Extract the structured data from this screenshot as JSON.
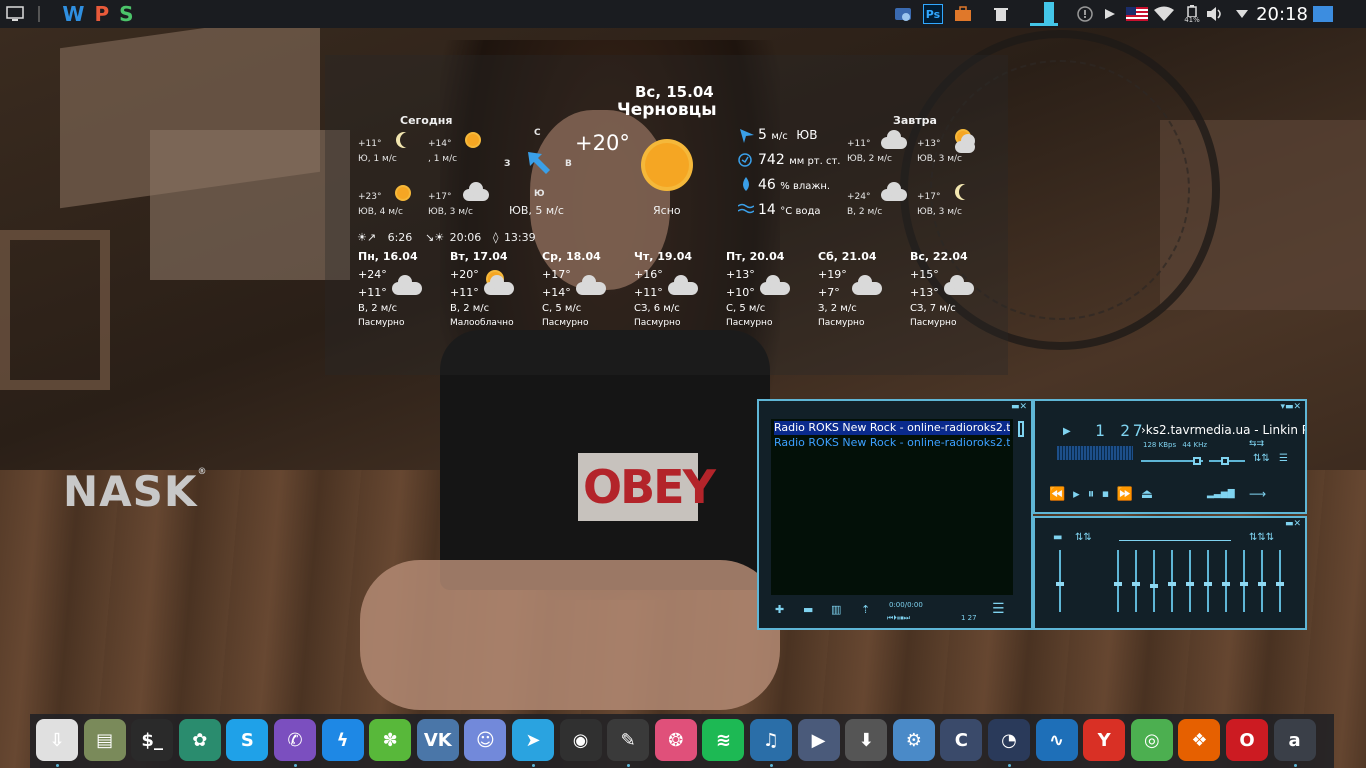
{
  "top_panel": {
    "wps_letters": [
      "W",
      "P",
      "S"
    ],
    "wps_colors": [
      "#2f8fe0",
      "#e85a3a",
      "#4cc46a"
    ],
    "tray_icons": [
      "desktop-icon",
      "lock-screen-icon",
      "photoshop-icon",
      "toolbox-icon",
      "trash-icon",
      "window-thumbnail-icon",
      "info-icon",
      "play-icon",
      "us-flag-icon",
      "wifi-icon",
      "battery-icon",
      "volume-icon",
      "dropdown-icon",
      "show-desktop-icon"
    ],
    "photoshop_label": "Ps",
    "battery_percent": "41%",
    "clock": "20:18"
  },
  "weather": {
    "date": "Вс, 15.04",
    "city": "Черновцы",
    "today_label": "Сегодня",
    "tomorrow_label": "Завтра",
    "current_temp": "+20°",
    "compass": {
      "n": "С",
      "w": "З",
      "e": "В",
      "s": "Ю"
    },
    "wind_text": "ЮВ, 5 м/с",
    "condition": "Ясно",
    "wind_speed": "5",
    "wind_unit": "м/с",
    "wind_dir": "ЮВ",
    "pressure": "742",
    "pressure_unit": "мм рт. ст.",
    "humidity": "46",
    "humidity_unit": "% влажн.",
    "water_temp": "14",
    "water_unit": "°С вода",
    "sunrise": "6:26",
    "sunset": "20:06",
    "daylight": "13:39",
    "today_parts": [
      {
        "temp": "+11°",
        "wind": "Ю, 1 м/с",
        "icon": "moon-icon"
      },
      {
        "temp": "+14°",
        "wind": ", 1 м/с",
        "icon": "sun-icon"
      },
      {
        "temp": "+23°",
        "wind": "ЮВ, 4 м/с",
        "icon": "sun-icon"
      },
      {
        "temp": "+17°",
        "wind": "ЮВ, 3 м/с",
        "icon": "cloud-icon"
      }
    ],
    "tomorrow_parts": [
      {
        "temp": "+11°",
        "wind": "ЮВ, 2 м/с",
        "icon": "cloud-icon"
      },
      {
        "temp": "+13°",
        "wind": "ЮВ, 3 м/с",
        "icon": "sun-cloud-icon"
      },
      {
        "temp": "+24°",
        "wind": "В, 2 м/с",
        "icon": "cloud-icon"
      },
      {
        "temp": "+17°",
        "wind": "ЮВ, 3 м/с",
        "icon": "moon-icon"
      }
    ],
    "forecast": [
      {
        "day": "Пн, 16.04",
        "high": "+24°",
        "low": "+11°",
        "wind": "В, 2 м/с",
        "desc": "Пасмурно",
        "icon": "cloud-icon"
      },
      {
        "day": "Вт, 17.04",
        "high": "+20°",
        "low": "+11°",
        "wind": "В, 2 м/с",
        "desc": "Малооблачно",
        "icon": "sun-cloud-icon"
      },
      {
        "day": "Ср, 18.04",
        "high": "+17°",
        "low": "+14°",
        "wind": "С, 5 м/с",
        "desc": "Пасмурно",
        "icon": "cloud-icon"
      },
      {
        "day": "Чт, 19.04",
        "high": "+16°",
        "low": "+11°",
        "wind": "СЗ, 6 м/с",
        "desc": "Пасмурно",
        "icon": "cloud-icon"
      },
      {
        "day": "Пт, 20.04",
        "high": "+13°",
        "low": "+10°",
        "wind": "С, 5 м/с",
        "desc": "Пасмурно",
        "icon": "cloud-icon"
      },
      {
        "day": "Сб, 21.04",
        "high": "+19°",
        "low": "+7°",
        "wind": "З, 2 м/с",
        "desc": "Пасмурно",
        "icon": "cloud-icon"
      },
      {
        "day": "Вс, 22.04",
        "high": "+15°",
        "low": "+13°",
        "wind": "СЗ, 7 м/с",
        "desc": "Пасмурно",
        "icon": "cloud-icon"
      }
    ]
  },
  "wallpaper": {
    "logo": "NASK",
    "logo_mark": "®",
    "shirt_text": "OBEY"
  },
  "player": {
    "playlist": [
      "Radio ROKS New Rock - online-radioroks2.tav",
      "Radio ROKS New Rock - online-radioroks2.tav"
    ],
    "playlist_time": "0:00/0:00",
    "playlist_count": "1 27",
    "track_time": "1 27",
    "title_scroll": "›ks2.tavrmedia.ua - Linkin P",
    "bitrate": "128",
    "bitrate_unit": "KBps",
    "samplerate": "44",
    "samplerate_unit": "KHz"
  },
  "dock": {
    "apps": [
      {
        "name": "software-installer-icon",
        "color": "#e0e0e0",
        "glyph": "⇩",
        "running": true
      },
      {
        "name": "file-manager-icon",
        "color": "#7a8a5a",
        "glyph": "▤",
        "running": false
      },
      {
        "name": "terminal-icon",
        "color": "#2a2a2a",
        "glyph": "$_",
        "running": false
      },
      {
        "name": "system-settings-icon",
        "color": "#2a8c6e",
        "glyph": "✿",
        "running": false
      },
      {
        "name": "skype-icon",
        "color": "#1fa1e8",
        "glyph": "S",
        "running": false
      },
      {
        "name": "viber-icon",
        "color": "#7b4fbf",
        "glyph": "✆",
        "running": true
      },
      {
        "name": "messenger-icon",
        "color": "#1e88e5",
        "glyph": "ϟ",
        "running": false
      },
      {
        "name": "icq-icon",
        "color": "#58b83a",
        "glyph": "✽",
        "running": false
      },
      {
        "name": "vk-icon",
        "color": "#4a76a8",
        "glyph": "VK",
        "running": false
      },
      {
        "name": "discord-icon",
        "color": "#7289da",
        "glyph": "☺",
        "running": false
      },
      {
        "name": "telegram-icon",
        "color": "#2aa3e0",
        "glyph": "➤",
        "running": true
      },
      {
        "name": "obs-icon",
        "color": "#303030",
        "glyph": "◉",
        "running": false
      },
      {
        "name": "paint-icon",
        "color": "#3a3a3a",
        "glyph": "✎",
        "running": true
      },
      {
        "name": "photo-viewer-icon",
        "color": "#e0507a",
        "glyph": "❂",
        "running": false
      },
      {
        "name": "spotify-icon",
        "color": "#1db954",
        "glyph": "≋",
        "running": false
      },
      {
        "name": "audio-player-icon",
        "color": "#2a6ea8",
        "glyph": "♫",
        "running": true
      },
      {
        "name": "media-player-icon",
        "color": "#4a5a7a",
        "glyph": "▶",
        "running": false
      },
      {
        "name": "downloader-icon",
        "color": "#555555",
        "glyph": "⬇",
        "running": false
      },
      {
        "name": "network-icon",
        "color": "#4a8ac8",
        "glyph": "⚙",
        "running": false
      },
      {
        "name": "ccleaner-icon",
        "color": "#3a4a6a",
        "glyph": "C",
        "running": false
      },
      {
        "name": "disk-usage-icon",
        "color": "#2a3a5a",
        "glyph": "◔",
        "running": true
      },
      {
        "name": "audio-editor-icon",
        "color": "#1e6fb8",
        "glyph": "∿",
        "running": false
      },
      {
        "name": "yandex-browser-icon",
        "color": "#d93025",
        "glyph": "Y",
        "running": false
      },
      {
        "name": "chrome-icon",
        "color": "#4caf50",
        "glyph": "◎",
        "running": false
      },
      {
        "name": "firefox-icon",
        "color": "#e66000",
        "glyph": "❖",
        "running": false
      },
      {
        "name": "opera-icon",
        "color": "#cc1b22",
        "glyph": "O",
        "running": false
      },
      {
        "name": "audacious-icon",
        "color": "#3a3f48",
        "glyph": "a",
        "running": true
      }
    ]
  }
}
